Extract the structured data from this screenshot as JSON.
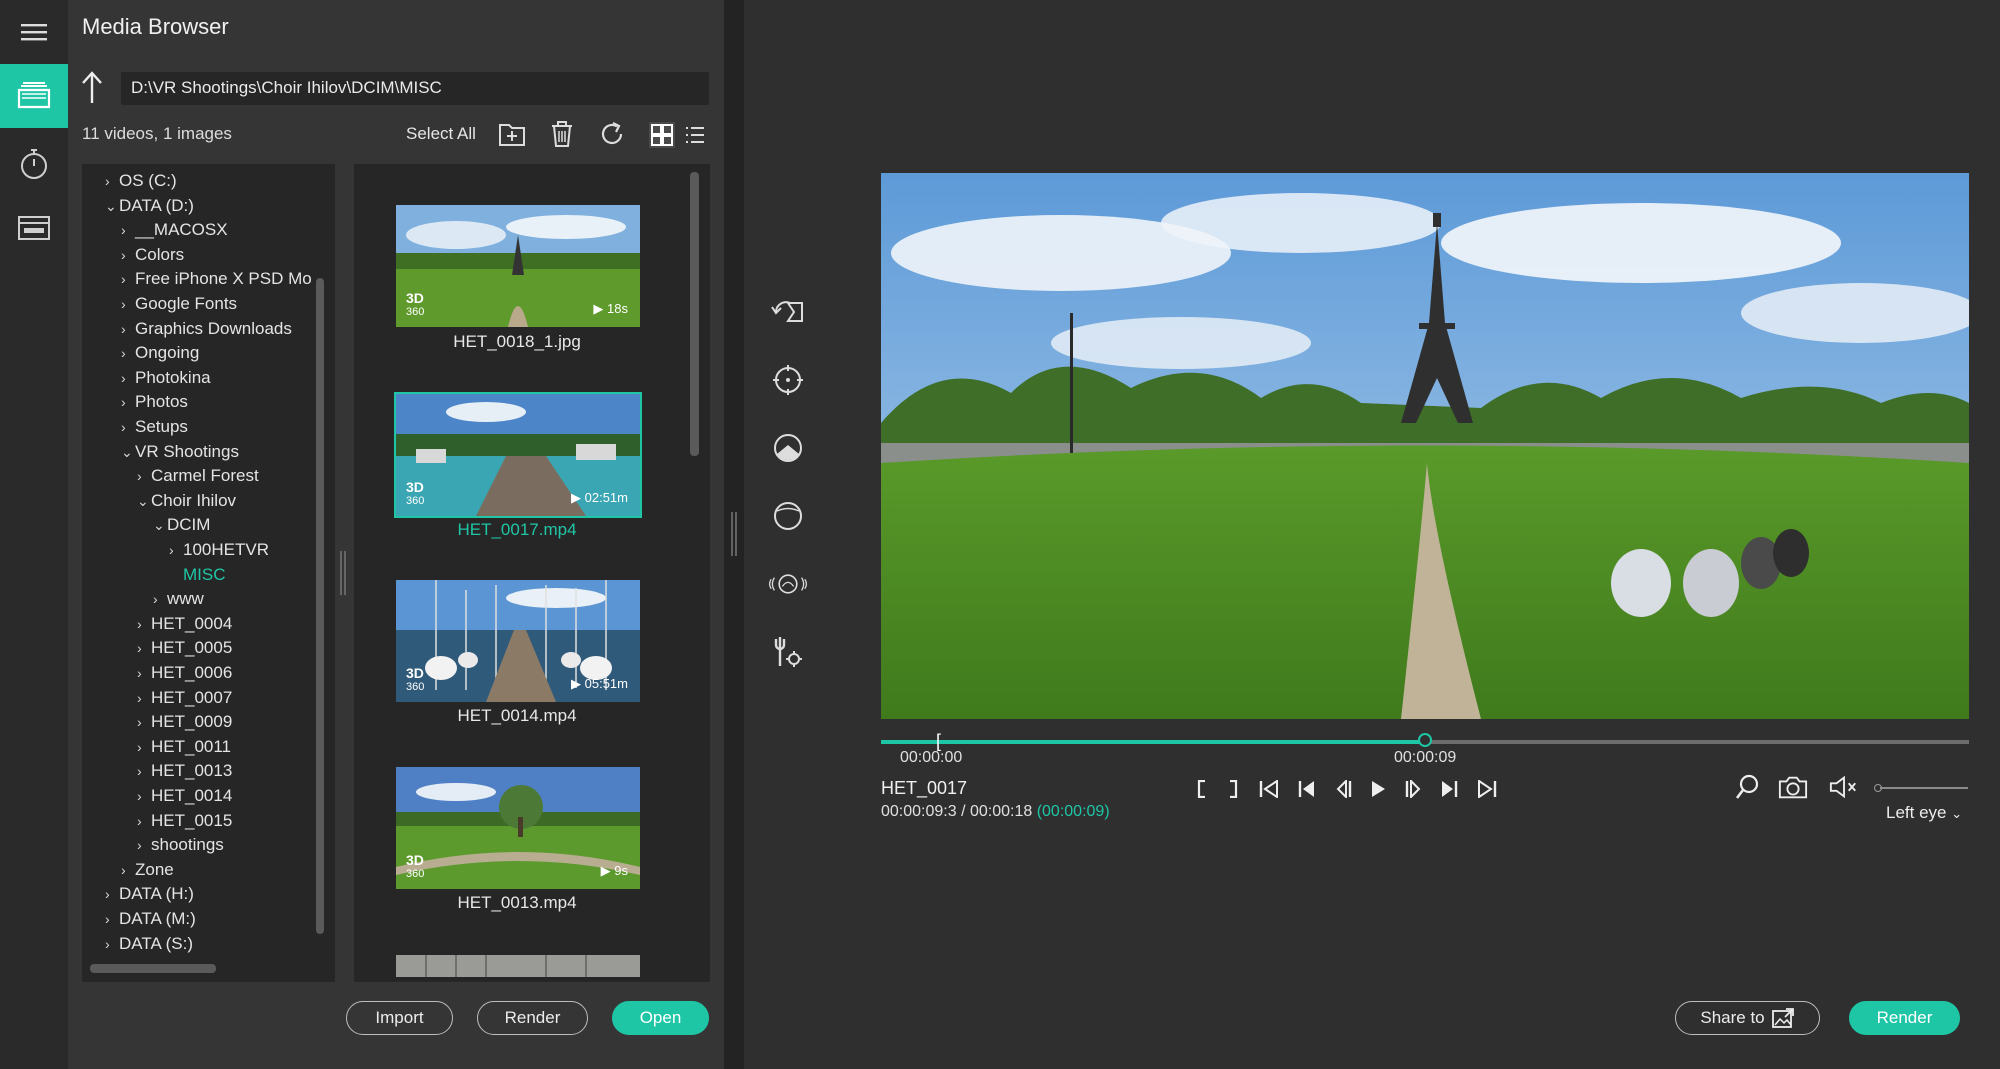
{
  "colors": {
    "accent": "#1fc6a6",
    "panel": "#353535",
    "well": "#262626",
    "background": "#2f2f2f"
  },
  "rail": {
    "items": [
      {
        "name": "menu-icon"
      },
      {
        "name": "media-browser-icon",
        "active": true
      },
      {
        "name": "timer-icon"
      },
      {
        "name": "render-queue-icon"
      }
    ]
  },
  "browser": {
    "title": "Media Browser",
    "path": "D:\\VR Shootings\\Choir Ihilov\\DCIM\\MISC",
    "counts": "11 videos, 1 images",
    "select_all": "Select All",
    "toolbar_icons": [
      "new-folder-icon",
      "trash-icon",
      "refresh-icon",
      "grid-view-icon",
      "list-view-icon"
    ],
    "tree": [
      {
        "label": "OS (C:)",
        "chev": "›"
      },
      {
        "label": "DATA (D:)",
        "chev": "⌄"
      },
      {
        "label": "__MACOSX",
        "chev": "›"
      },
      {
        "label": "Colors",
        "chev": "›"
      },
      {
        "label": "Free iPhone X PSD Mo",
        "chev": "›"
      },
      {
        "label": "Google Fonts",
        "chev": "›"
      },
      {
        "label": "Graphics Downloads",
        "chev": "›"
      },
      {
        "label": "Ongoing",
        "chev": "›"
      },
      {
        "label": "Photokina",
        "chev": "›"
      },
      {
        "label": "Photos",
        "chev": "›"
      },
      {
        "label": "Setups",
        "chev": "›"
      },
      {
        "label": "VR Shootings",
        "chev": "⌄"
      },
      {
        "label": "Carmel Forest",
        "chev": "›"
      },
      {
        "label": "Choir Ihilov",
        "chev": "⌄"
      },
      {
        "label": "DCIM",
        "chev": "⌄"
      },
      {
        "label": "100HETVR",
        "chev": "›"
      },
      {
        "label": "MISC",
        "chev": "",
        "selected": true
      },
      {
        "label": "www",
        "chev": "›"
      },
      {
        "label": "HET_0004",
        "chev": "›"
      },
      {
        "label": "HET_0005",
        "chev": "›"
      },
      {
        "label": "HET_0006",
        "chev": "›"
      },
      {
        "label": "HET_0007",
        "chev": "›"
      },
      {
        "label": "HET_0009",
        "chev": "›"
      },
      {
        "label": "HET_0011",
        "chev": "›"
      },
      {
        "label": "HET_0013",
        "chev": "›"
      },
      {
        "label": "HET_0014",
        "chev": "›"
      },
      {
        "label": "HET_0015",
        "chev": "›"
      },
      {
        "label": "shootings",
        "chev": "›"
      },
      {
        "label": "Zone",
        "chev": "›"
      },
      {
        "label": "DATA (H:)",
        "chev": "›"
      },
      {
        "label": "DATA (M:)",
        "chev": "›"
      },
      {
        "label": "DATA (S:)",
        "chev": "›"
      }
    ],
    "thumbnails": [
      {
        "file": "HET_0018_1.jpg",
        "badge": "3D",
        "badge_sub": "360",
        "duration": "▶ 18s"
      },
      {
        "file": "HET_0017.mp4",
        "badge": "3D",
        "badge_sub": "360",
        "duration": "▶ 02:51m",
        "selected": true
      },
      {
        "file": "HET_0014.mp4",
        "badge": "3D",
        "badge_sub": "360",
        "duration": "▶ 05:51m"
      },
      {
        "file": "HET_0013.mp4",
        "badge": "3D",
        "badge_sub": "360",
        "duration": "▶ 9s"
      }
    ],
    "buttons": {
      "import": "Import",
      "render": "Render",
      "open": "Open"
    }
  },
  "player": {
    "side_tools": [
      "rotate-view-icon",
      "target-icon",
      "horizon-icon",
      "circle-view-icon",
      "stabilize-icon",
      "settings-tools-icon"
    ],
    "timeline": {
      "start_label": "00:00:00",
      "cursor_label": "00:00:09",
      "progress": 0.5
    },
    "clip_name": "HET_0017",
    "time_current": "00:00:09:3",
    "time_separator": " / ",
    "time_total": "00:00:18",
    "time_selection": "(00:00:09)",
    "transport_icons": [
      "mark-in-icon",
      "mark-out-icon",
      "go-to-start-icon",
      "previous-icon",
      "step-back-icon",
      "play-icon",
      "step-forward-icon",
      "next-icon",
      "go-to-end-icon"
    ],
    "right_icons": [
      "zoom-icon",
      "snapshot-icon",
      "mute-icon"
    ],
    "volume": 0.0,
    "eye_mode": "Left eye",
    "buttons": {
      "share": "Share to",
      "render": "Render"
    }
  }
}
